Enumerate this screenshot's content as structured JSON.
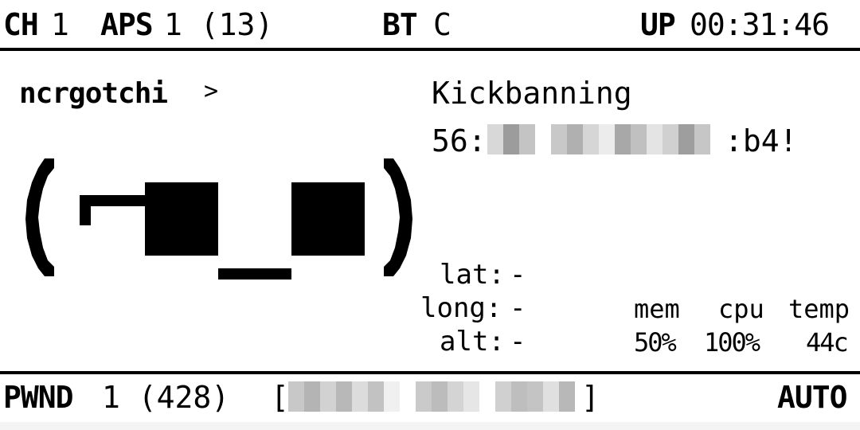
{
  "header": {
    "ch_label": "CH",
    "ch_value": "1",
    "aps_label": "APS",
    "aps_value": "1 (13)",
    "bt_label": "BT",
    "bt_value": "C",
    "up_label": "UP",
    "up_value": "00:31:46"
  },
  "main": {
    "name": "ncrgotchi",
    "prompt": ">",
    "face": "(⌐■_■)",
    "status_line": "Kickbanning",
    "mac_prefix": "56:",
    "mac_suffix": ":b4!"
  },
  "gps": {
    "lat_label": "lat:",
    "lat_value": "-",
    "long_label": "long:",
    "long_value": "-",
    "alt_label": "alt:",
    "alt_value": "-"
  },
  "stats": {
    "mem_label": "mem",
    "cpu_label": "cpu",
    "temp_label": "temp",
    "mem_value": "50%",
    "cpu_value": "100%",
    "temp_value": "44c"
  },
  "footer": {
    "pwnd_label": "PWND",
    "pwnd_value": "1 (428)",
    "bracket_open": "[",
    "bracket_close": "]",
    "mode": "AUTO"
  },
  "colors": {
    "ink": "#000000",
    "paper": "#ffffff",
    "redact_light": "#e0e0e0",
    "redact_mid": "#c4c4c4",
    "redact_dark": "#9c9c9c"
  }
}
